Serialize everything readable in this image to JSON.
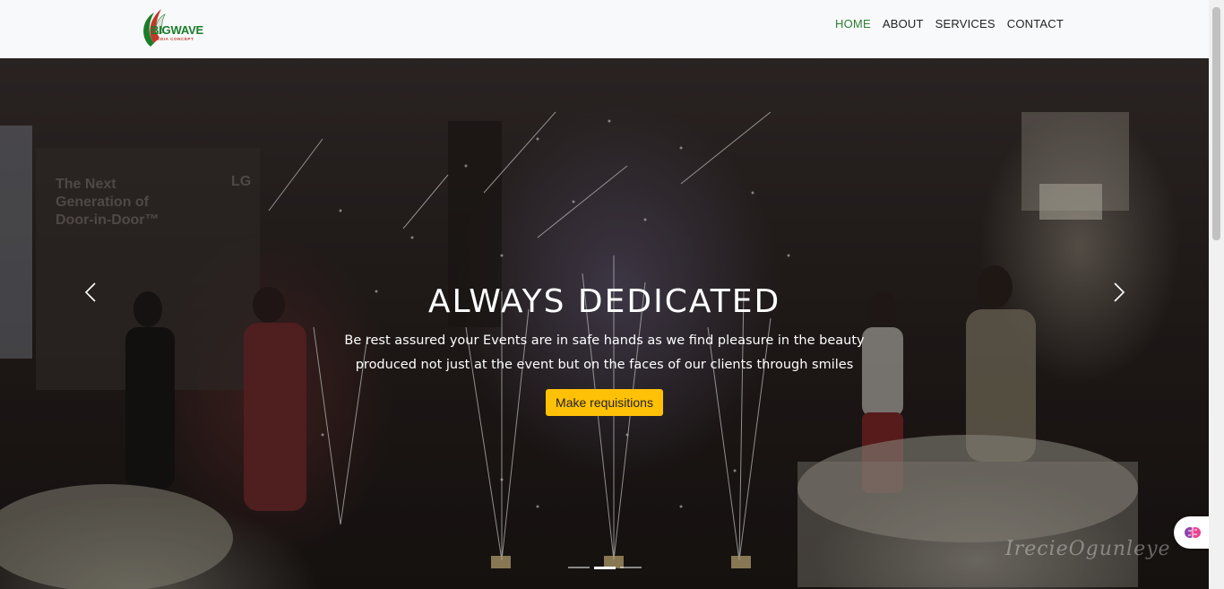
{
  "brand": {
    "name": "BIGWAVE",
    "tagline": "MEDIA CONCEPT",
    "colors": {
      "green": "#1a7d2a",
      "red": "#c0392b"
    }
  },
  "nav": {
    "items": [
      {
        "label": "HOME",
        "active": true
      },
      {
        "label": "ABOUT",
        "active": false
      },
      {
        "label": "SERVICES",
        "active": false
      },
      {
        "label": "CONTACT",
        "active": false
      }
    ],
    "active_color": "#2e7d32"
  },
  "hero": {
    "title": "ALWAYS DEDICATED",
    "text": "Be rest assured your Events are in safe hands as we find pleasure in the beauty produced not just at the event but on the faces of our clients through smiles",
    "cta_label": "Make requisitions",
    "cta_color": "#ffc107",
    "signature": "IrecieOgunleye",
    "slides_total": 3,
    "active_slide": 2
  },
  "icons": {
    "prev": "chevron-left-icon",
    "next": "chevron-right-icon",
    "widget": "brain-icon"
  }
}
